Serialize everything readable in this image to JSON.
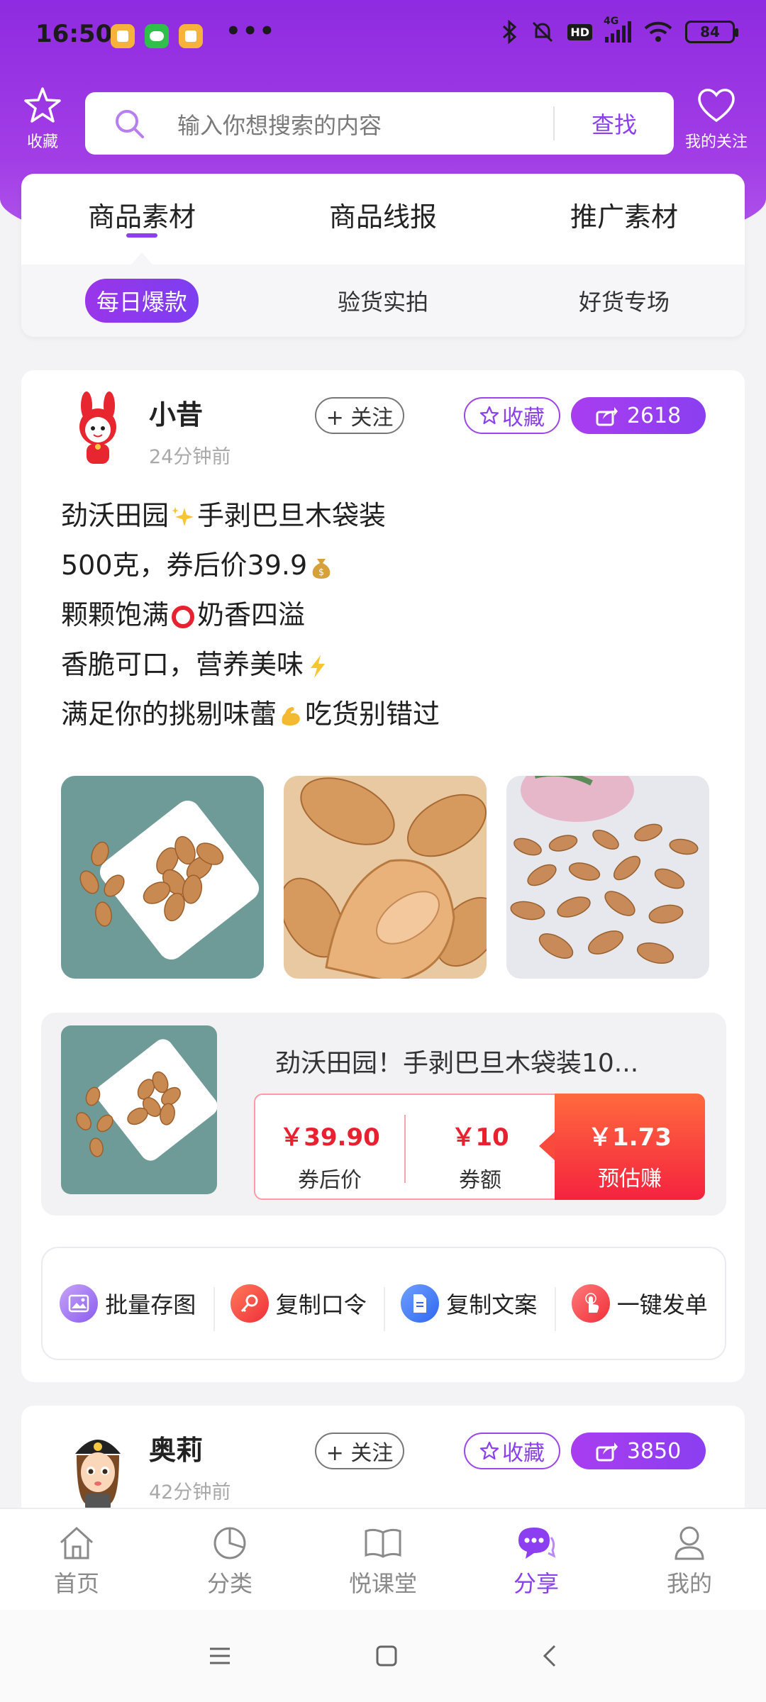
{
  "status_bar": {
    "time": "16:50",
    "more": "•••",
    "network": "4G",
    "hd": "HD",
    "battery": "84"
  },
  "header": {
    "left_label": "收藏",
    "right_label": "我的关注",
    "search_placeholder": "输入你想搜索的内容",
    "search_button": "查找"
  },
  "main_tabs": [
    {
      "label": "商品素材",
      "active": true
    },
    {
      "label": "商品线报",
      "active": false
    },
    {
      "label": "推广素材",
      "active": false
    }
  ],
  "sub_tabs": [
    {
      "label": "每日爆款",
      "active": true
    },
    {
      "label": "验货实拍",
      "active": false
    },
    {
      "label": "好货专场",
      "active": false
    }
  ],
  "posts": [
    {
      "user": "小昔",
      "time": "24分钟前",
      "follow_label": "+ 关注",
      "collect_label": "收藏",
      "share_count": "2618",
      "text_lines": [
        {
          "before": "劲沃田园",
          "emoji": "sparkles",
          "after": "手剥巴旦木袋装"
        },
        {
          "before": "500克，券后价39.9",
          "emoji": "money-bag",
          "after": ""
        },
        {
          "before": "颗颗饱满",
          "emoji": "red-circle",
          "after": "奶香四溢"
        },
        {
          "before": "香脆可口，营养美味",
          "emoji": "zap",
          "after": ""
        },
        {
          "before": "满足你的挑剔味蕾",
          "emoji": "muscle",
          "after": "吃货别错过"
        }
      ],
      "product": {
        "title": "劲沃田园！手剥巴旦木袋装10...",
        "price_after_coupon": "￥39.90",
        "price_after_coupon_label": "券后价",
        "coupon": "￥10",
        "coupon_label": "券额",
        "earn": "￥1.73",
        "earn_label": "预估赚"
      },
      "actions": [
        "批量存图",
        "复制口令",
        "复制文案",
        "一键发单"
      ]
    },
    {
      "user": "奥莉",
      "time": "42分钟前",
      "follow_label": "+ 关注",
      "collect_label": "收藏",
      "share_count": "3850"
    }
  ],
  "bottom_nav": [
    {
      "label": "首页",
      "icon": "home-icon"
    },
    {
      "label": "分类",
      "icon": "pie-icon"
    },
    {
      "label": "悦课堂",
      "icon": "book-icon"
    },
    {
      "label": "分享",
      "icon": "chat-icon",
      "active": true
    },
    {
      "label": "我的",
      "icon": "user-icon"
    }
  ],
  "colors": {
    "brand": "#8b3ff0",
    "price": "#e8202f",
    "earn": "#f4233f"
  }
}
